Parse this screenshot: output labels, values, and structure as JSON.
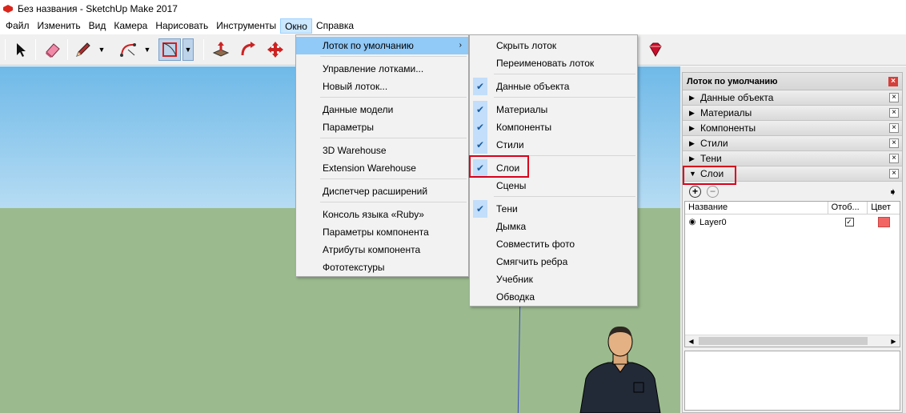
{
  "window": {
    "title": "Без названия - SketchUp Make 2017"
  },
  "menubar": [
    {
      "label": "Файл"
    },
    {
      "label": "Изменить"
    },
    {
      "label": "Вид"
    },
    {
      "label": "Камера"
    },
    {
      "label": "Нарисовать"
    },
    {
      "label": "Инструменты"
    },
    {
      "label": "Окно",
      "active": true
    },
    {
      "label": "Справка"
    }
  ],
  "toolbar": {
    "tools": [
      "select-tool",
      "eraser-tool",
      "pencil-tool",
      "arc-tool",
      "shape-tool",
      "push-pull-tool",
      "follow-me-tool",
      "move-tool",
      "extension-warehouse-tool"
    ]
  },
  "window_menu": {
    "items": [
      {
        "label": "Лоток по умолчанию",
        "highlighted": true,
        "submenu": true
      },
      {
        "label": "Управление лотками..."
      },
      {
        "label": "Новый лоток..."
      },
      {
        "label": "Данные модели"
      },
      {
        "label": "Параметры"
      },
      {
        "label": "3D Warehouse"
      },
      {
        "label": "Extension Warehouse"
      },
      {
        "label": "Диспетчер расширений"
      },
      {
        "label": "Консоль языка «Ruby»"
      },
      {
        "label": "Параметры компонента"
      },
      {
        "label": "Атрибуты компонента"
      },
      {
        "label": "Фототекстуры"
      }
    ]
  },
  "tray_submenu": {
    "items": [
      {
        "label": "Скрыть лоток",
        "checked": false
      },
      {
        "label": "Переименовать лоток",
        "checked": false
      },
      {
        "label": "Данные объекта",
        "checked": true
      },
      {
        "label": "Материалы",
        "checked": true
      },
      {
        "label": "Компоненты",
        "checked": true
      },
      {
        "label": "Стили",
        "checked": true
      },
      {
        "label": "Слои",
        "checked": true
      },
      {
        "label": "Сцены",
        "checked": false
      },
      {
        "label": "Тени",
        "checked": true
      },
      {
        "label": "Дымка",
        "checked": false
      },
      {
        "label": "Совместить фото",
        "checked": false
      },
      {
        "label": "Смягчить ребра",
        "checked": false
      },
      {
        "label": "Учебник",
        "checked": false
      },
      {
        "label": "Обводка",
        "checked": false
      }
    ]
  },
  "tray": {
    "title": "Лоток по умолчанию",
    "close_glyph": "×",
    "sections": [
      {
        "label": "Данные объекта",
        "expanded": false
      },
      {
        "label": "Материалы",
        "expanded": false
      },
      {
        "label": "Компоненты",
        "expanded": false
      },
      {
        "label": "Стили",
        "expanded": false
      },
      {
        "label": "Тени",
        "expanded": false
      },
      {
        "label": "Слои",
        "expanded": true
      }
    ],
    "layers": {
      "columns": [
        "Название",
        "Отоб...",
        "Цвет"
      ],
      "rows": [
        {
          "name": "Layer0",
          "visible": true,
          "active": true,
          "color": "#f26565"
        }
      ]
    }
  },
  "colors": {
    "highlight": "#91c9f7",
    "annotation_red": "#d9001b",
    "sky": "#8cc9ee",
    "ground": "#9bbb8e"
  }
}
